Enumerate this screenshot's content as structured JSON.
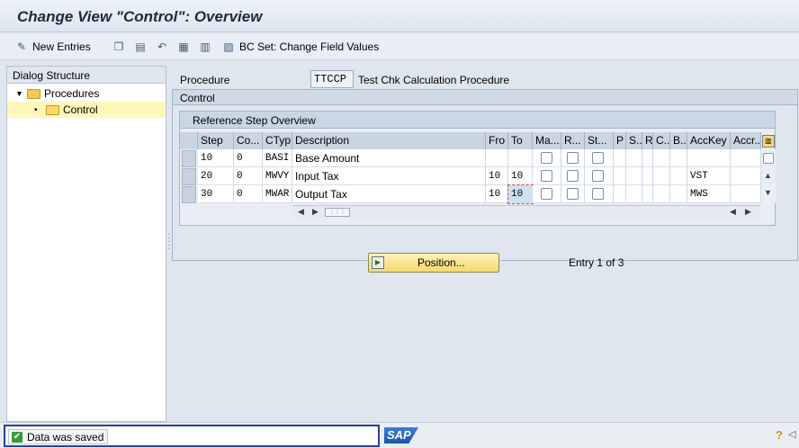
{
  "window": {
    "title": "Change View \"Control\": Overview"
  },
  "toolbar": {
    "new_entries": "New Entries",
    "bc_set": "BC Set: Change Field Values",
    "icons": [
      "glasses-edit-icon",
      "copy-icon",
      "delete-icon",
      "undo-icon",
      "select-all-icon",
      "select-block-icon",
      "deselect-icon",
      "bcset-icon"
    ]
  },
  "dialog_structure": {
    "header": "Dialog Structure",
    "items": [
      {
        "label": "Procedures"
      },
      {
        "label": "Control"
      }
    ]
  },
  "procedure": {
    "label": "Procedure",
    "code": "TTCCP",
    "description": "Test Chk Calculation Procedure"
  },
  "control": {
    "group_title": "Control",
    "table_title": "Reference Step Overview",
    "columns": [
      "Step",
      "Co...",
      "CTyp",
      "Description",
      "Fro",
      "To",
      "Ma...",
      "R...",
      "St...",
      "P",
      "S..",
      "R",
      "C..",
      "B..",
      "AccKey",
      "Accr..."
    ],
    "rows": [
      {
        "step": "10",
        "counter": "0",
        "ctyp": "BASI",
        "desc": "Base Amount",
        "from": "",
        "to": "",
        "acckey": ""
      },
      {
        "step": "20",
        "counter": "0",
        "ctyp": "MWVY",
        "desc": "Input Tax",
        "from": "10",
        "to": "10",
        "acckey": "VST"
      },
      {
        "step": "30",
        "counter": "0",
        "ctyp": "MWAR",
        "desc": "Output Tax",
        "from": "10",
        "to": "10",
        "acckey": "MWS"
      }
    ],
    "position_button": "Position...",
    "entry_info": "Entry 1 of 3"
  },
  "status": {
    "message": "Data was saved"
  },
  "brand": {
    "logo": "SAP"
  }
}
